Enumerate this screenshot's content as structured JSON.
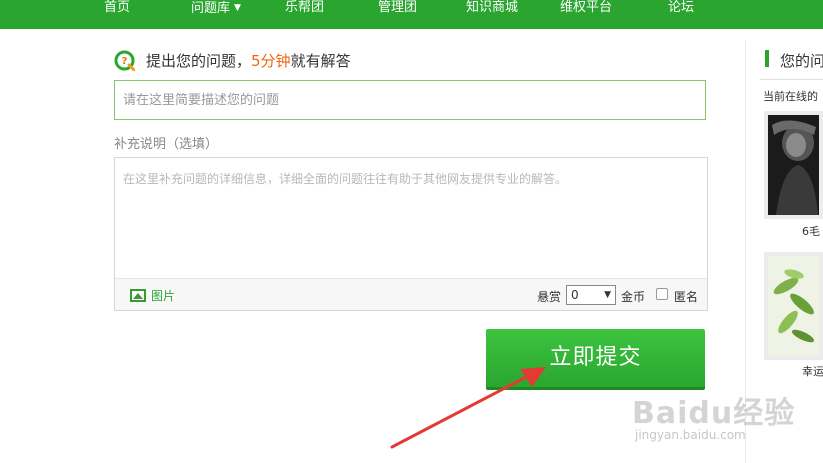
{
  "nav": {
    "items": [
      {
        "label": "首页"
      },
      {
        "label": "问题库",
        "has_dropdown": true
      },
      {
        "label": "乐帮团"
      },
      {
        "label": "管理团"
      },
      {
        "label": "知识商城"
      },
      {
        "label": "维权平台"
      },
      {
        "label": "论坛"
      }
    ]
  },
  "ask": {
    "title_prefix": "提出您的问题，",
    "title_highlight": "5分钟",
    "title_suffix": "就有解答",
    "title_placeholder": "请在这里简要描述您的问题",
    "supplement_label": "补充说明（选填）",
    "detail_placeholder": "在这里补充问题的详细信息，详细全面的问题往往有助于其他网友提供专业的解答。",
    "image_label": "图片",
    "reward_label": "悬赏",
    "reward_value": "0",
    "coin_label": "金币",
    "anonymous_label": "匿名",
    "anonymous_checked": false,
    "submit_label": "立即提交"
  },
  "sidebar": {
    "title": "您的问",
    "online_label": "当前在线的",
    "users": [
      {
        "name": "6毛"
      },
      {
        "name": "幸运"
      }
    ]
  },
  "watermark": {
    "logo_text": "Baidu经验",
    "url": "jingyan.baidu.com"
  },
  "colors": {
    "nav_bg": "#2aa52f",
    "accent": "#2aa52f",
    "highlight": "#f0670f",
    "arrow": "#e53935"
  }
}
